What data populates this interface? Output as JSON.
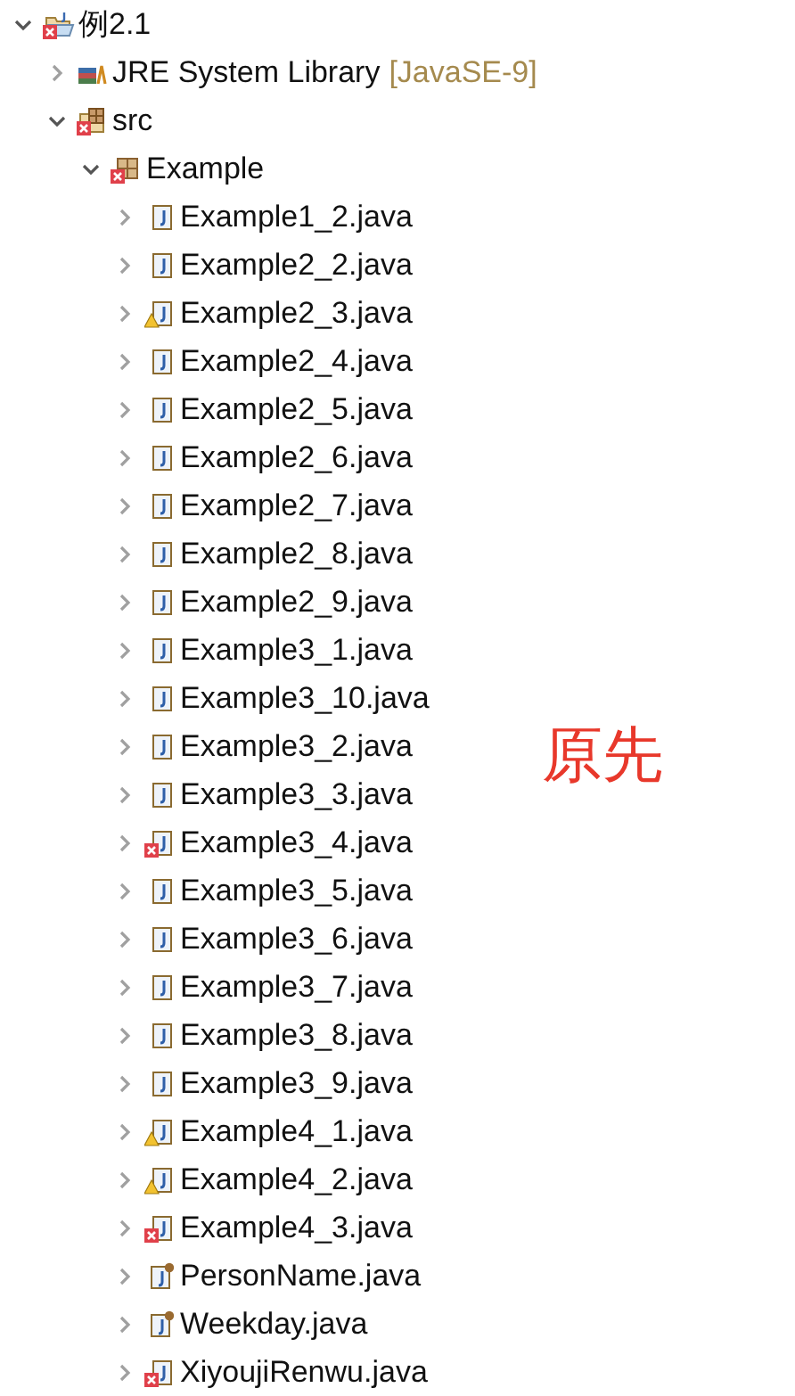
{
  "tree": [
    {
      "kind": "project",
      "label": "例2.1",
      "expanded": true,
      "error": true,
      "children": [
        {
          "kind": "library",
          "label": "JRE System Library",
          "decoration": "[JavaSE-9]",
          "expanded": false
        },
        {
          "kind": "folder",
          "label": "src",
          "expanded": true,
          "error": true,
          "children": [
            {
              "kind": "package",
              "label": "Example",
              "expanded": true,
              "error": true,
              "children": [
                {
                  "kind": "java",
                  "label": "Example1_2.java",
                  "expanded": false,
                  "error": false,
                  "warning": false
                },
                {
                  "kind": "java",
                  "label": "Example2_2.java",
                  "expanded": false,
                  "error": false,
                  "warning": false
                },
                {
                  "kind": "java",
                  "label": "Example2_3.java",
                  "expanded": false,
                  "error": false,
                  "warning": true
                },
                {
                  "kind": "java",
                  "label": "Example2_4.java",
                  "expanded": false,
                  "error": false,
                  "warning": false
                },
                {
                  "kind": "java",
                  "label": "Example2_5.java",
                  "expanded": false,
                  "error": false,
                  "warning": false
                },
                {
                  "kind": "java",
                  "label": "Example2_6.java",
                  "expanded": false,
                  "error": false,
                  "warning": false
                },
                {
                  "kind": "java",
                  "label": "Example2_7.java",
                  "expanded": false,
                  "error": false,
                  "warning": false
                },
                {
                  "kind": "java",
                  "label": "Example2_8.java",
                  "expanded": false,
                  "error": false,
                  "warning": false
                },
                {
                  "kind": "java",
                  "label": "Example2_9.java",
                  "expanded": false,
                  "error": false,
                  "warning": false
                },
                {
                  "kind": "java",
                  "label": "Example3_1.java",
                  "expanded": false,
                  "error": false,
                  "warning": false
                },
                {
                  "kind": "java",
                  "label": "Example3_10.java",
                  "expanded": false,
                  "error": false,
                  "warning": false
                },
                {
                  "kind": "java",
                  "label": "Example3_2.java",
                  "expanded": false,
                  "error": false,
                  "warning": false
                },
                {
                  "kind": "java",
                  "label": "Example3_3.java",
                  "expanded": false,
                  "error": false,
                  "warning": false
                },
                {
                  "kind": "java",
                  "label": "Example3_4.java",
                  "expanded": false,
                  "error": true,
                  "warning": false
                },
                {
                  "kind": "java",
                  "label": "Example3_5.java",
                  "expanded": false,
                  "error": false,
                  "warning": false
                },
                {
                  "kind": "java",
                  "label": "Example3_6.java",
                  "expanded": false,
                  "error": false,
                  "warning": false
                },
                {
                  "kind": "java",
                  "label": "Example3_7.java",
                  "expanded": false,
                  "error": false,
                  "warning": false
                },
                {
                  "kind": "java",
                  "label": "Example3_8.java",
                  "expanded": false,
                  "error": false,
                  "warning": false
                },
                {
                  "kind": "java",
                  "label": "Example3_9.java",
                  "expanded": false,
                  "error": false,
                  "warning": false
                },
                {
                  "kind": "java",
                  "label": "Example4_1.java",
                  "expanded": false,
                  "error": false,
                  "warning": true
                },
                {
                  "kind": "java",
                  "label": "Example4_2.java",
                  "expanded": false,
                  "error": false,
                  "warning": true
                },
                {
                  "kind": "java",
                  "label": "Example4_3.java",
                  "expanded": false,
                  "error": true,
                  "warning": false
                },
                {
                  "kind": "enum",
                  "label": "PersonName.java",
                  "expanded": false,
                  "error": false,
                  "warning": false
                },
                {
                  "kind": "enum",
                  "label": "Weekday.java",
                  "expanded": false,
                  "error": false,
                  "warning": false
                },
                {
                  "kind": "java",
                  "label": "XiyoujiRenwu.java",
                  "expanded": false,
                  "error": true,
                  "warning": false
                }
              ]
            }
          ]
        }
      ]
    }
  ],
  "annotation": "原先"
}
